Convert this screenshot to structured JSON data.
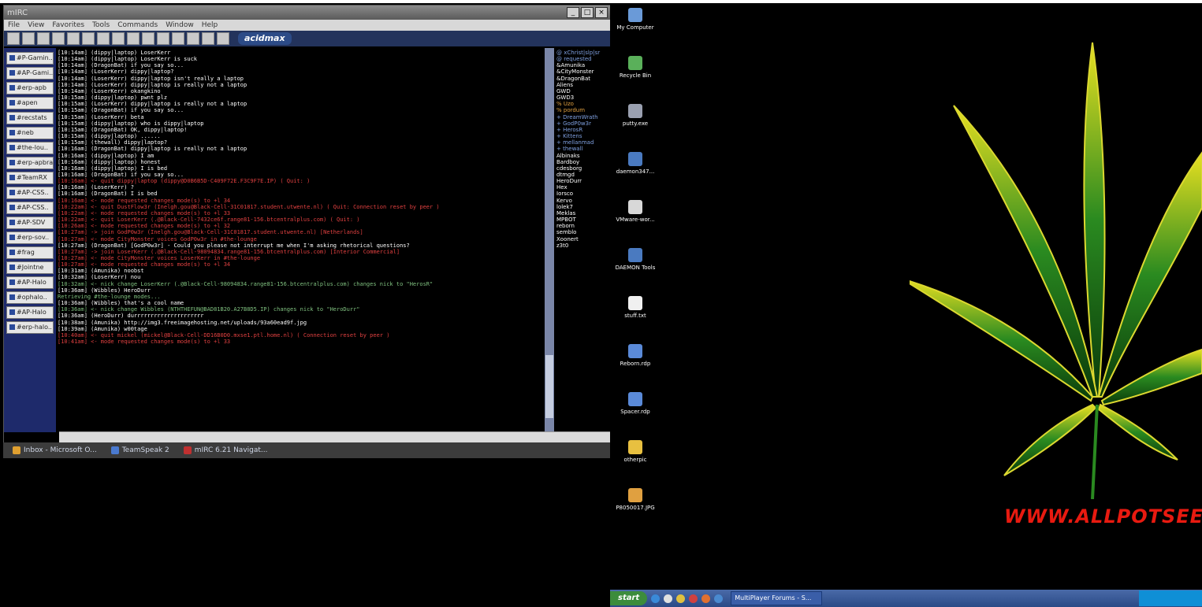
{
  "window": {
    "title": "mIRC",
    "menu": [
      "File",
      "View",
      "Favorites",
      "Tools",
      "Commands",
      "Window",
      "Help"
    ],
    "brand": "acidmax",
    "switchbar": [
      "#P-Gamin..",
      "#AP-Gami..",
      "#erp-apb",
      "#apen",
      "#recstats",
      "#neb",
      "#the-lou..",
      "#erp-apbra..",
      "#TeamRX",
      "#AP-CSS..",
      "#AP-CSS..",
      "#AP-SDV",
      "#erp-sov..",
      "#frag",
      "#Jointne",
      "#AP-Halo",
      "#ophalo..",
      "#AP-Halo",
      "#erp-halo.."
    ]
  },
  "chat_lines": [
    {
      "text": "[10:14am] (dippy|laptop) LoserKerr",
      "color": "#ffffff"
    },
    {
      "text": "[10:14am] (dippy|laptop) LoserKerr is suck",
      "color": "#ffffff"
    },
    {
      "text": "[10:14am] (DragonBat) if you say so...",
      "color": "#ffffff"
    },
    {
      "text": "[10:14am] (LoserKerr) dippy|laptop?",
      "color": "#ffffff"
    },
    {
      "text": "[10:14am] (LoserKerr) dippy|laptop isn't really a laptop",
      "color": "#ffffff"
    },
    {
      "text": "[10:14am] (LoserKerr) dippy|laptop is really not a laptop",
      "color": "#ffffff"
    },
    {
      "text": "[10:14am] (LoserKerr) okangkino",
      "color": "#ffffff"
    },
    {
      "text": "[10:15am] (dippy|laptop) pwnt plz",
      "color": "#ffffff"
    },
    {
      "text": "[10:15am] (LoserKerr) dippy|laptop is really not a laptop",
      "color": "#ffffff"
    },
    {
      "text": "[10:15am] (DragonBat) if you say so...",
      "color": "#ffffff"
    },
    {
      "text": "[10:15am] (LoserKerr) beta",
      "color": "#ffffff"
    },
    {
      "text": "[10:15am] (dippy|laptop) who is dippy|laptop",
      "color": "#ffffff"
    },
    {
      "text": "[10:15am] (DragonBat) OK, dippy|laptop!",
      "color": "#ffffff"
    },
    {
      "text": "[10:15am] (dippy|laptop) ......",
      "color": "#ffffff"
    },
    {
      "text": "[10:15am] (thewall) dippy|laptop?",
      "color": "#ffffff"
    },
    {
      "text": "[10:16am] (DragonBat) dippy|laptop is really not a laptop",
      "color": "#ffffff"
    },
    {
      "text": "[10:16am] (dippy|laptop) I am",
      "color": "#ffffff"
    },
    {
      "text": "[10:16am] (dippy|laptop) honest",
      "color": "#ffffff"
    },
    {
      "text": "[10:16am] (dippy|laptop) I is bed",
      "color": "#ffffff"
    },
    {
      "text": "[10:16am] (DragonBat) if you say so...",
      "color": "#ffffff"
    },
    {
      "text": "[10:16am]   <- quit dippy|laptop (dippy@D0B6B5D-C409F72E.F3C9F7E.IP) ( Quit: )",
      "color": "#e04040"
    },
    {
      "text": "[10:16am] (LoserKerr) ?",
      "color": "#ffffff"
    },
    {
      "text": "[10:16am] (DragonBat) I is bed",
      "color": "#ffffff"
    },
    {
      "text": "[10:16am]   <- mode requested changes mode(s) to +l 34",
      "color": "#e04040"
    },
    {
      "text": "[10:22am]   <- quit DustFlow3r (Inelgh.gou@Black-Cell-31C01817.student.utwente.nl) ( Quit: Connection reset by peer )",
      "color": "#e04040"
    },
    {
      "text": "[10:22am]   <- mode requested changes mode(s) to +l 33",
      "color": "#e04040"
    },
    {
      "text": "[10:22am]   <- quit LoserKerr (.@Black-Cell-7432ce6f.range81-156.btcentralplus.com) ( Quit: )",
      "color": "#e04040"
    },
    {
      "text": "[10:26am]   <- mode requested changes mode(s) to +l 32",
      "color": "#e04040"
    },
    {
      "text": "[10:27am]   -> join GodP0w3r (Inelgh.gou@Black-Cell-31C01817.student.utwente.nl) [Netherlands]",
      "color": "#e04040"
    },
    {
      "text": "[10:27am]   <- mode CityMonster voices GodP0w3r in #the-lounge",
      "color": "#e04040"
    },
    {
      "text": "[10:27am] (DragonBat) [GodP0w3r] - Could you please not interrupt me when I'm asking rhetorical questions?",
      "color": "#ffffff"
    },
    {
      "text": "[10:27am]   -> join LoserKerr (.@Black-Cell-98094834.range81-156.btcentralplus.com) [Interior Commercial]",
      "color": "#e04040"
    },
    {
      "text": "[10:27am]   <- mode CityMonster voices LoserKerr in #the-lounge",
      "color": "#e04040"
    },
    {
      "text": "[10:27am]   <- mode requested changes mode(s) to +l 34",
      "color": "#e04040"
    },
    {
      "text": "[10:31am] (Amunika) noobst",
      "color": "#ffffff"
    },
    {
      "text": "[10:32am] (LoserKerr) nou",
      "color": "#ffffff"
    },
    {
      "text": "[10:32am]   <- nick change LoserKerr (.@Black-Cell-98094834.range81-156.btcentralplus.com) changes nick to \"HerosR\"",
      "color": "#7fc07f"
    },
    {
      "text": "[10:36am] (Wibbles) HeroDurr",
      "color": "#ffffff"
    },
    {
      "text": "  Retrieving #the-lounge modes...",
      "color": "#7fc07f"
    },
    {
      "text": "[10:36am] (Wibbles) that's a cool name",
      "color": "#ffffff"
    },
    {
      "text": "[10:36am]   <- nick change Wibbles (NTHTHEFUN@BAD81B20.A27B8D5.IP) changes nick to \"HeroDurr\"",
      "color": "#7fc07f"
    },
    {
      "text": "[10:36am] (HeroDurr) durrrrrrrrrrrrrrrrrrrrr",
      "color": "#ffffff"
    },
    {
      "text": "[10:38am] (Amunika) http://img3.freeimagehosting.net/uploads/93a60ead9f.jpg",
      "color": "#ffffff"
    },
    {
      "text": "[10:39am] (Amunika) w00tage",
      "color": "#ffffff"
    },
    {
      "text": "[10:40am]   <- quit mickel (mickel@Black-Cell-DD16B0D0.mxse1.ptl.home.nl) ( Connection reset by peer )",
      "color": "#e04040"
    },
    {
      "text": "[10:41am]   <- mode requested changes mode(s) to +l 33",
      "color": "#e04040"
    }
  ],
  "nicklist": [
    {
      "text": "@ xChrist|slp|sr",
      "color": "#7fa0e0"
    },
    {
      "text": "@ requested",
      "color": "#7fa0e0"
    },
    {
      "text": "&Amunika",
      "color": "#ffffff"
    },
    {
      "text": "&CityMonster",
      "color": "#ffffff"
    },
    {
      "text": "&DragonBat",
      "color": "#ffffff"
    },
    {
      "text": "Aliens",
      "color": "#ffffff"
    },
    {
      "text": "GWD",
      "color": "#ffffff"
    },
    {
      "text": "GWD3",
      "color": "#ffffff"
    },
    {
      "text": "% Uzo",
      "color": "#e0a040"
    },
    {
      "text": "% pordum",
      "color": "#e0a040"
    },
    {
      "text": "+ DreamWrath",
      "color": "#7fa0e0"
    },
    {
      "text": "+ GodP0w3r",
      "color": "#7fa0e0"
    },
    {
      "text": "+ HerosR",
      "color": "#7fa0e0"
    },
    {
      "text": "+ Kittens",
      "color": "#7fa0e0"
    },
    {
      "text": "+ mellanmad",
      "color": "#7fa0e0"
    },
    {
      "text": "+ thewall",
      "color": "#7fa0e0"
    },
    {
      "text": "Albinaks",
      "color": "#ffffff"
    },
    {
      "text": "Bardboy",
      "color": "#ffffff"
    },
    {
      "text": "cdesborg",
      "color": "#ffffff"
    },
    {
      "text": "dtmgd",
      "color": "#ffffff"
    },
    {
      "text": "HeroDurr",
      "color": "#ffffff"
    },
    {
      "text": "Hex",
      "color": "#ffffff"
    },
    {
      "text": "Iorsco",
      "color": "#ffffff"
    },
    {
      "text": "Kervo",
      "color": "#ffffff"
    },
    {
      "text": "lolek7",
      "color": "#ffffff"
    },
    {
      "text": "Meklas",
      "color": "#ffffff"
    },
    {
      "text": "MPBOT",
      "color": "#ffffff"
    },
    {
      "text": "reborn",
      "color": "#ffffff"
    },
    {
      "text": "semblo",
      "color": "#ffffff"
    },
    {
      "text": "Xoonert",
      "color": "#ffffff"
    },
    {
      "text": "z3t0",
      "color": "#ffffff"
    }
  ],
  "left_taskbar": [
    {
      "label": "Inbox - Microsoft O...",
      "color": "#e0a030"
    },
    {
      "label": "TeamSpeak 2",
      "color": "#4a7ad0"
    },
    {
      "label": "mIRC 6.21 Navigat...",
      "color": "#c03030"
    }
  ],
  "desktop_icons": [
    {
      "label": "My Computer",
      "color": "#6a9ad8"
    },
    {
      "label": "Recycle Bin",
      "color": "#5ab05a"
    },
    {
      "label": "putty.exe",
      "color": "#9aa0b0"
    },
    {
      "label": "daemon347...",
      "color": "#4a7ac0"
    },
    {
      "label": "VMware-wor...",
      "color": "#d8d8d8"
    },
    {
      "label": "DAEMON Tools",
      "color": "#4a7ac0"
    },
    {
      "label": "stuff.txt",
      "color": "#f0f0f0"
    },
    {
      "label": "Reborn.rdp",
      "color": "#5a8ad8"
    },
    {
      "label": "Spacer.rdp",
      "color": "#5a8ad8"
    },
    {
      "label": "otherpic",
      "color": "#e8c040"
    },
    {
      "label": "P8050017.JPG",
      "color": "#e0a040"
    }
  ],
  "watermark": "WWW.ALLPOTSEED",
  "xp_taskbar": {
    "start": "start",
    "task": "MultiPlayer Forums - S..."
  }
}
